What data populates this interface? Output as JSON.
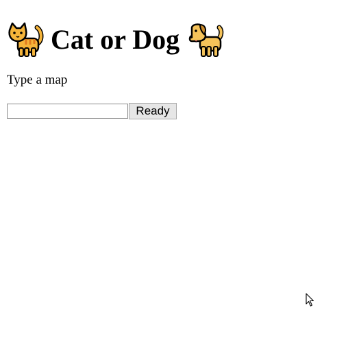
{
  "header": {
    "title": "Cat or Dog",
    "left_icon": "cat-emoji-icon",
    "right_icon": "dog-emoji-icon"
  },
  "prompt": "Type a map",
  "form": {
    "input_value": "",
    "input_placeholder": "",
    "button_label": "Ready"
  },
  "colors": {
    "background": "#ffffff",
    "text": "#000000",
    "button_bg": "#e6e6e6",
    "emoji_fur": "#f5b43a",
    "emoji_stripes": "#e07a1f"
  }
}
